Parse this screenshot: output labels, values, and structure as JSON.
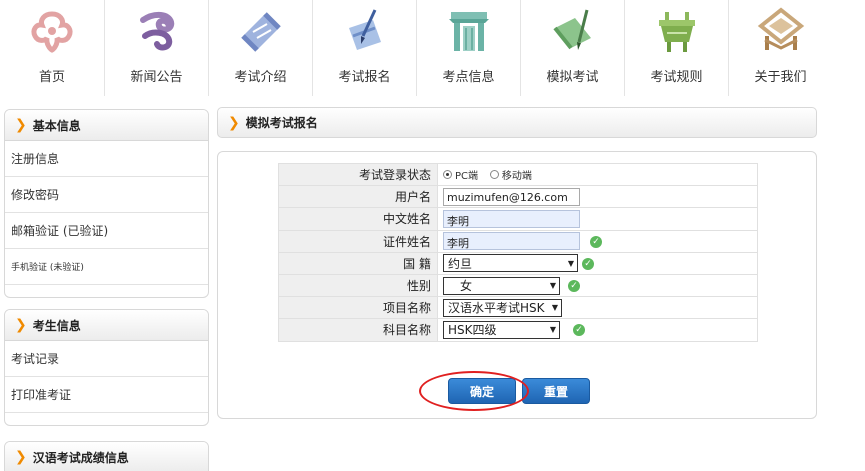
{
  "nav": {
    "items": [
      {
        "label": "首页",
        "icon": "ruyi-cloud-icon"
      },
      {
        "label": "新闻公告",
        "icon": "purple-scroll-icon"
      },
      {
        "label": "考试介绍",
        "icon": "blue-scroll-icon"
      },
      {
        "label": "考试报名",
        "icon": "brush-paper-icon"
      },
      {
        "label": "考点信息",
        "icon": "gate-icon"
      },
      {
        "label": "模拟考试",
        "icon": "green-scroll-icon"
      },
      {
        "label": "考试规则",
        "icon": "bronze-ding-icon"
      },
      {
        "label": "关于我们",
        "icon": "pavilion-icon"
      }
    ]
  },
  "sidebar": {
    "basic": {
      "title": "基本信息",
      "items": [
        "注册信息",
        "修改密码",
        "邮箱验证 (已验证)",
        "手机验证 (未验证)"
      ]
    },
    "candidate": {
      "title": "考生信息",
      "items": [
        "考试记录",
        "打印准考证"
      ]
    },
    "scores": {
      "title": "汉语考试成绩信息"
    }
  },
  "main": {
    "title": "模拟考试报名",
    "form": {
      "login_status_label": "考试登录状态",
      "login_option_pc": "PC端",
      "login_option_mobile": "移动端",
      "login_selected": "PC端",
      "username_label": "用户名",
      "username_value": "muzimufen@126.com",
      "chinese_name_label": "中文姓名",
      "chinese_name_value": "李明",
      "id_name_label": "证件姓名",
      "id_name_value": "李明",
      "nationality_label": "国 籍",
      "nationality_value": "约旦",
      "gender_label": "性别",
      "gender_value": "女",
      "project_label": "项目名称",
      "project_value": "汉语水平考试HSK",
      "subject_label": "科目名称",
      "subject_value": "HSK四级"
    },
    "buttons": {
      "confirm": "确定",
      "reset": "重置"
    }
  },
  "colors": {
    "accent_orange": "#f08a00",
    "button_blue": "#2a74c4",
    "check_green": "#5cb85c",
    "highlight_red": "#e02020",
    "field_blue": "#e8effd"
  }
}
